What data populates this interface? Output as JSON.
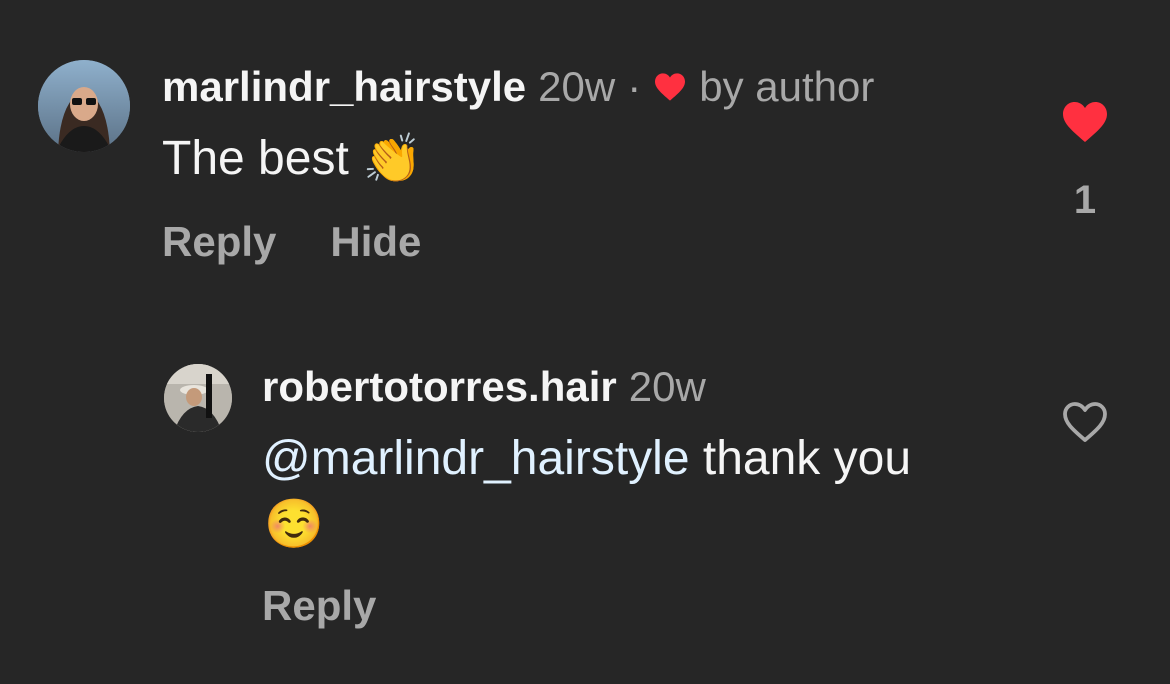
{
  "comment": {
    "username": "marlindr_hairstyle",
    "time": "20w",
    "separator": "·",
    "liked_by_author_label": "by author",
    "text": "The best",
    "emoji": "👏",
    "actions": {
      "reply": "Reply",
      "hide": "Hide"
    },
    "like_count": "1",
    "liked": true
  },
  "reply": {
    "username": "robertotorres.hair",
    "time": "20w",
    "mention": "@marlindr_hairstyle",
    "text": " thank you",
    "emoji": "☺️",
    "actions": {
      "reply": "Reply"
    },
    "liked": false
  },
  "colors": {
    "background": "#262626",
    "like_red": "#ff3040",
    "mention": "#e0f1ff",
    "secondary_text": "#a8a8a8"
  },
  "icons": {
    "comment_like": "heart-filled-icon",
    "reply_like": "heart-outline-icon",
    "author_heart": "heart-filled-icon"
  }
}
